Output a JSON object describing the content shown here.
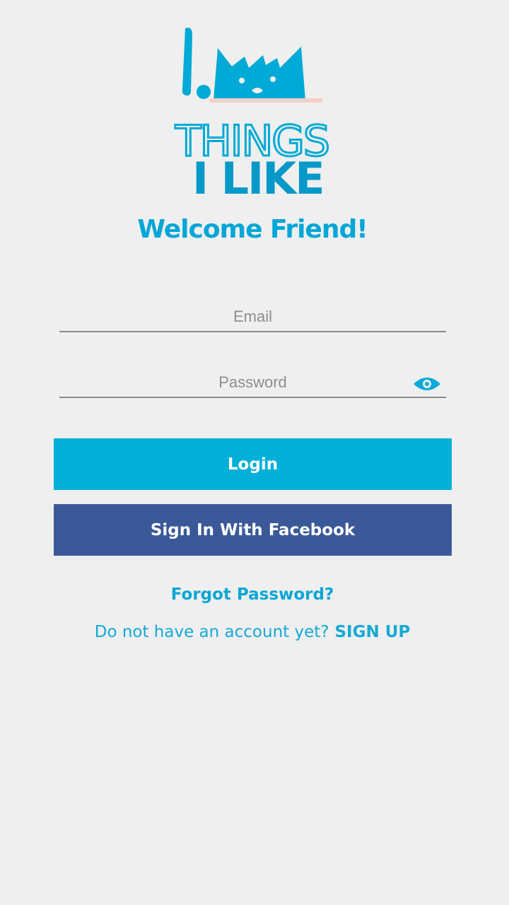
{
  "app": {
    "logo_icon": "things-i-like-cat-logo",
    "brand_color": "#00a6d6"
  },
  "header": {
    "welcome": "Welcome Friend!"
  },
  "form": {
    "email_placeholder": "Email",
    "password_placeholder": "Password",
    "password_toggle_icon": "eye-icon"
  },
  "buttons": {
    "login": "Login",
    "facebook": "Sign In With Facebook",
    "login_color": "#02afd8",
    "facebook_color": "#3b5998"
  },
  "links": {
    "forgot_password": "Forgot Password?",
    "no_account": "Do not have an account yet?",
    "signup": "SIGN UP"
  }
}
